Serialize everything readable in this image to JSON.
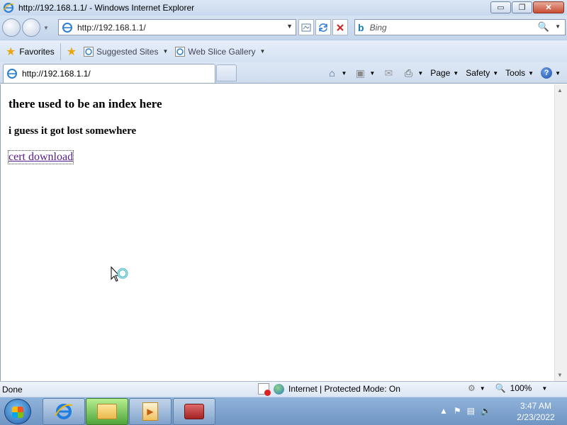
{
  "window": {
    "title": "http://192.168.1.1/ - Windows Internet Explorer",
    "minimize_glyph": "▭",
    "maximize_glyph": "❐",
    "close_glyph": "✕"
  },
  "address_bar": {
    "url": "http://192.168.1.1/",
    "dropdown_glyph": "▼"
  },
  "search": {
    "placeholder": "Bing",
    "logo_glyph": "b",
    "search_glyph": "🔍",
    "dropdown_glyph": "▼"
  },
  "favorites_bar": {
    "favorites_label": "Favorites",
    "items": [
      {
        "label": "Suggested Sites"
      },
      {
        "label": "Web Slice Gallery"
      }
    ]
  },
  "tab": {
    "label": "http://192.168.1.1/"
  },
  "command_bar": {
    "page_label": "Page",
    "safety_label": "Safety",
    "tools_label": "Tools",
    "help_glyph": "?"
  },
  "page": {
    "heading": "there used to be an index here",
    "subheading": "i guess it got lost somewhere",
    "link_text": "cert download"
  },
  "status_bar": {
    "status": "Done",
    "zone": "Internet | Protected Mode: On",
    "zoom": "100%"
  },
  "taskbar": {
    "time": "3:47 AM",
    "date": "2/23/2022"
  },
  "colors": {
    "link_visited": "#551a8b",
    "titlebar": "#c9d9ee"
  }
}
